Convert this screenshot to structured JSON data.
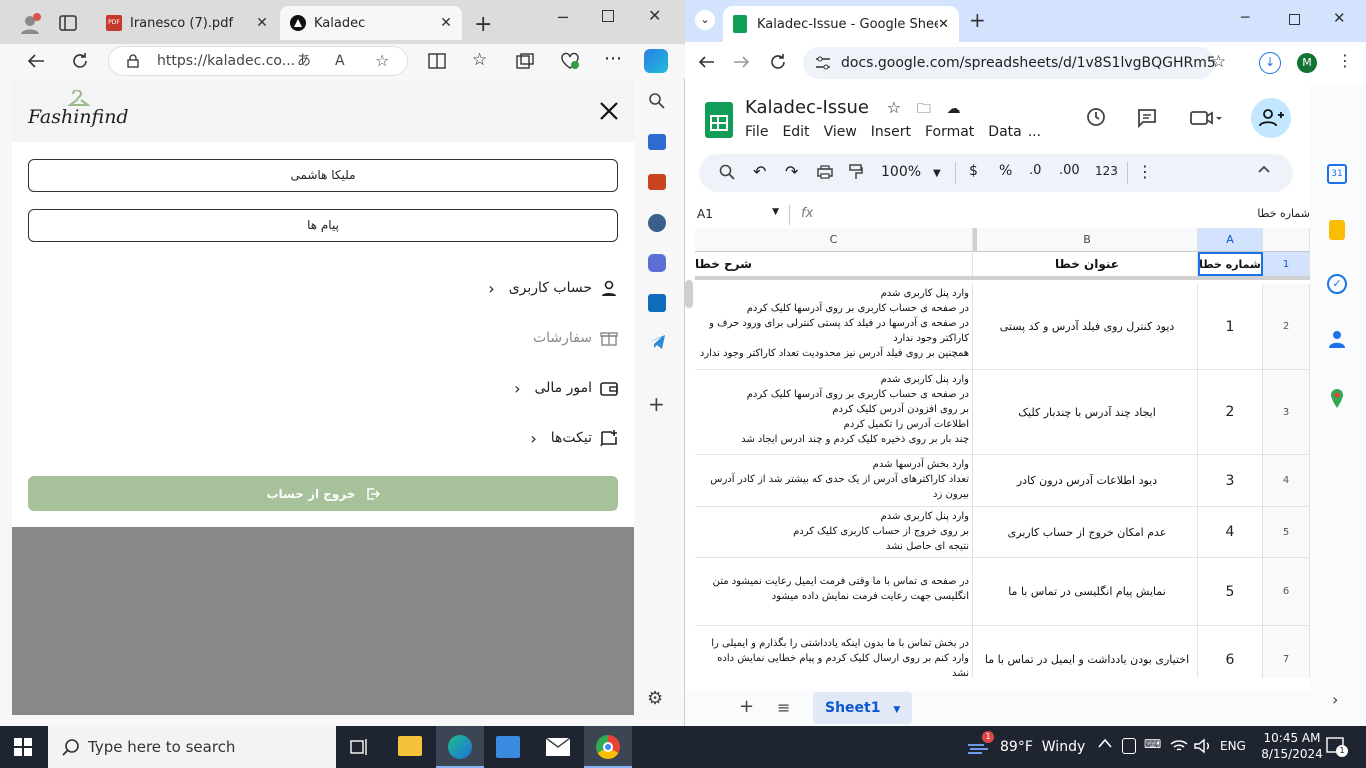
{
  "edge": {
    "tabs": [
      {
        "title": "Iranesco (7).pdf"
      },
      {
        "title": "Kaladec"
      }
    ],
    "url": "https://kaladec.co..."
  },
  "site": {
    "logo_text": "Fashinfind",
    "user_name": "ملیکا هاشمی",
    "messages": "پیام ها",
    "menu": [
      {
        "label": "حساب کاربری",
        "icon": "user-icon",
        "chevron": true,
        "disabled": false
      },
      {
        "label": "سفارشات",
        "icon": "gift-icon",
        "chevron": false,
        "disabled": true
      },
      {
        "label": "امور مالی",
        "icon": "wallet-icon",
        "chevron": true,
        "disabled": false
      },
      {
        "label": "تیکت‌ها",
        "icon": "ticket-icon",
        "chevron": true,
        "disabled": false
      }
    ],
    "logout": "خروج از حساب",
    "logout_color": "#a7c29a"
  },
  "chrome": {
    "tab_title": "Kaladec-Issue - Google Sheets",
    "url": "docs.google.com/spreadsheets/d/1v8S1lvgBQGHRm5Ye...",
    "avatar_letter": "M"
  },
  "sheets": {
    "title": "Kaladec-Issue",
    "menu": [
      "File",
      "Edit",
      "View",
      "Insert",
      "Format",
      "Data",
      "..."
    ],
    "zoom": "100%",
    "fmt": {
      "currency": "$",
      "percent": "%",
      "dec_less": ".0",
      "dec_more": ".00",
      "numfmt": "123"
    },
    "name_box": "A1",
    "fx": "fx",
    "formula_value": "شماره خطا",
    "columns": [
      "C",
      "B",
      "A"
    ],
    "rows": [
      {
        "n": "1",
        "a": "شماره خطا",
        "b": "عنوان خطا",
        "c": "شرح خطا",
        "header": true
      },
      {
        "n": "2",
        "a": "1",
        "b": "دیود کنترل روی فیلد آدرس و کد پستی",
        "c": "وارد پنل کاربری شدم\nدر صفحه ی حساب کاربری بر روی آدرسها کلیک کردم\nدر صفحه ی آدرسها در فیلد کد پستی کنترلی برای ورود حرف و کاراکتر وجود ندارد\nهمچنین بر روی فیلد آدرس نیز محدودیت تعداد کاراکتر وجود ندارد"
      },
      {
        "n": "3",
        "a": "2",
        "b": "ایجاد چند آدرس با چندبار کلیک",
        "c": "وارد پنل کاربری شدم\nدر صفحه ی حساب کاربری بر روی آدرسها کلیک کردم\nبر روی افزودن آدرس کلیک کردم\nاطلاعات آدرس را تکمیل کردم\nچند بار بر روی ذخیره کلیک کردم و چند ادرس ایجاد شد"
      },
      {
        "n": "4",
        "a": "3",
        "b": "دیود اطلاعات آدرس درون کادر",
        "c": "وارد بخش آدرسها شدم\nتعداد کاراکترهای آدرس از یک حدی که بیشتر شد از کادر آدرس بیرون زد"
      },
      {
        "n": "5",
        "a": "4",
        "b": "عدم امکان خروج از حساب کاربری",
        "c": "وارد پنل کاربری شدم\nبر روی خروج از حساب کاربری کلیک کردم\nنتیجه ای حاصل نشد"
      },
      {
        "n": "6",
        "a": "5",
        "b": "نمایش پیام انگلیسی در تماس با ما",
        "c": "در صفحه ی تماس با ما وقتی فرمت ایمیل رعایت نمیشود متن انگلیسی جهت رعایت فرمت نمایش داده میشود"
      },
      {
        "n": "7",
        "a": "6",
        "b": "اختیاری بودن یادداشت و ایمیل در تماس با ما",
        "c": "در بخش تماس با ما بدون اینکه یادداشتی را بگذارم و ایمیلی را وارد کنم بر روی ارسال کلیک کردم و پیام خطایی نمایش داده نشد\nیادداشت و ایمیل باید اجباری باشد"
      }
    ],
    "sheet_tab": "Sheet1"
  },
  "taskbar": {
    "search_placeholder": "Type here to search",
    "weather": "89°F  Windy",
    "weather_badge": "1",
    "lang": "ENG",
    "time": "10:45 AM",
    "date": "8/15/2024",
    "notif_count": "1"
  }
}
